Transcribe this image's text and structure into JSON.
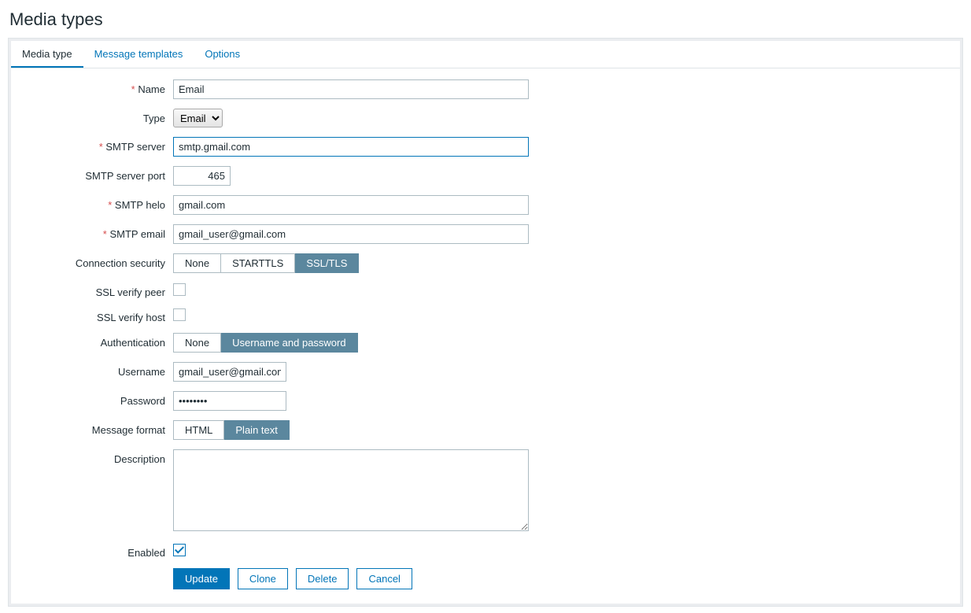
{
  "page": {
    "title": "Media types"
  },
  "tabs": [
    {
      "label": "Media type",
      "active": true
    },
    {
      "label": "Message templates",
      "active": false
    },
    {
      "label": "Options",
      "active": false
    }
  ],
  "labels": {
    "name": "Name",
    "type": "Type",
    "smtp_server": "SMTP server",
    "smtp_port": "SMTP server port",
    "smtp_helo": "SMTP helo",
    "smtp_email": "SMTP email",
    "conn_security": "Connection security",
    "ssl_verify_peer": "SSL verify peer",
    "ssl_verify_host": "SSL verify host",
    "authentication": "Authentication",
    "username": "Username",
    "password": "Password",
    "message_format": "Message format",
    "description": "Description",
    "enabled": "Enabled"
  },
  "values": {
    "name": "Email",
    "type_selected": "Email",
    "smtp_server": "smtp.gmail.com",
    "smtp_port": "465",
    "smtp_helo": "gmail.com",
    "smtp_email": "gmail_user@gmail.com",
    "conn_security": [
      "None",
      "STARTTLS",
      "SSL/TLS"
    ],
    "conn_security_selected": 2,
    "ssl_verify_peer": false,
    "ssl_verify_host": false,
    "authentication": [
      "None",
      "Username and password"
    ],
    "authentication_selected": 1,
    "username": "gmail_user@gmail.com",
    "password": "••••••••",
    "message_format": [
      "HTML",
      "Plain text"
    ],
    "message_format_selected": 1,
    "description": "",
    "enabled": true
  },
  "type_options": [
    "Email"
  ],
  "buttons": {
    "update": "Update",
    "clone": "Clone",
    "delete": "Delete",
    "cancel": "Cancel"
  }
}
